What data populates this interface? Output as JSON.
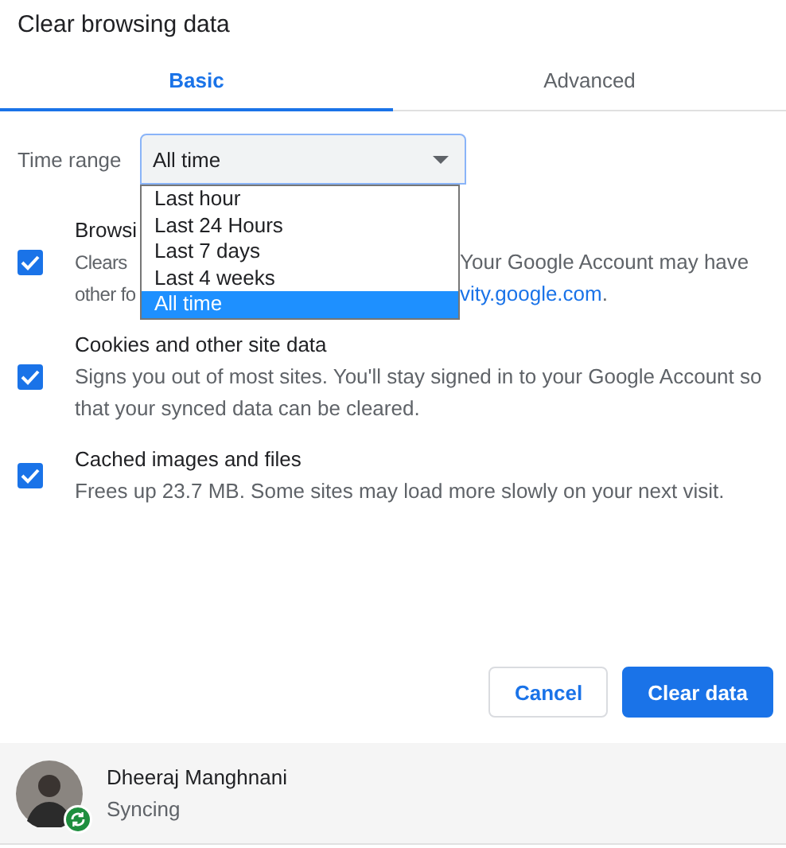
{
  "dialog": {
    "title": "Clear browsing data"
  },
  "tabs": [
    {
      "label": "Basic",
      "selected": true
    },
    {
      "label": "Advanced",
      "selected": false
    }
  ],
  "time_range": {
    "label": "Time range",
    "value": "All time",
    "expanded": true,
    "options": [
      {
        "label": "Last hour",
        "selected": false
      },
      {
        "label": "Last 24 Hours",
        "selected": false
      },
      {
        "label": "Last 7 days",
        "selected": false
      },
      {
        "label": "Last 4 weeks",
        "selected": false
      },
      {
        "label": "All time",
        "selected": true
      }
    ]
  },
  "items": [
    {
      "title": "Browsi",
      "checked": true,
      "lines": [
        {
          "left": "Clears",
          "right": "Your Google Account may have"
        },
        {
          "left": "other fo",
          "link": "vity.google.com",
          "after": "."
        }
      ]
    },
    {
      "title": "Cookies and other site data",
      "checked": true,
      "description": "Signs you out of most sites. You'll stay signed in to your Google Account so that your synced data can be cleared."
    },
    {
      "title": "Cached images and files",
      "checked": true,
      "description": "Frees up 23.7 MB. Some sites may load more slowly on your next visit."
    }
  ],
  "buttons": [
    {
      "label": "Cancel",
      "kind": "secondary"
    },
    {
      "label": "Clear data",
      "kind": "primary"
    }
  ],
  "account": {
    "name": "Dheeraj Manghnani",
    "status": "Syncing",
    "syncing": true
  }
}
